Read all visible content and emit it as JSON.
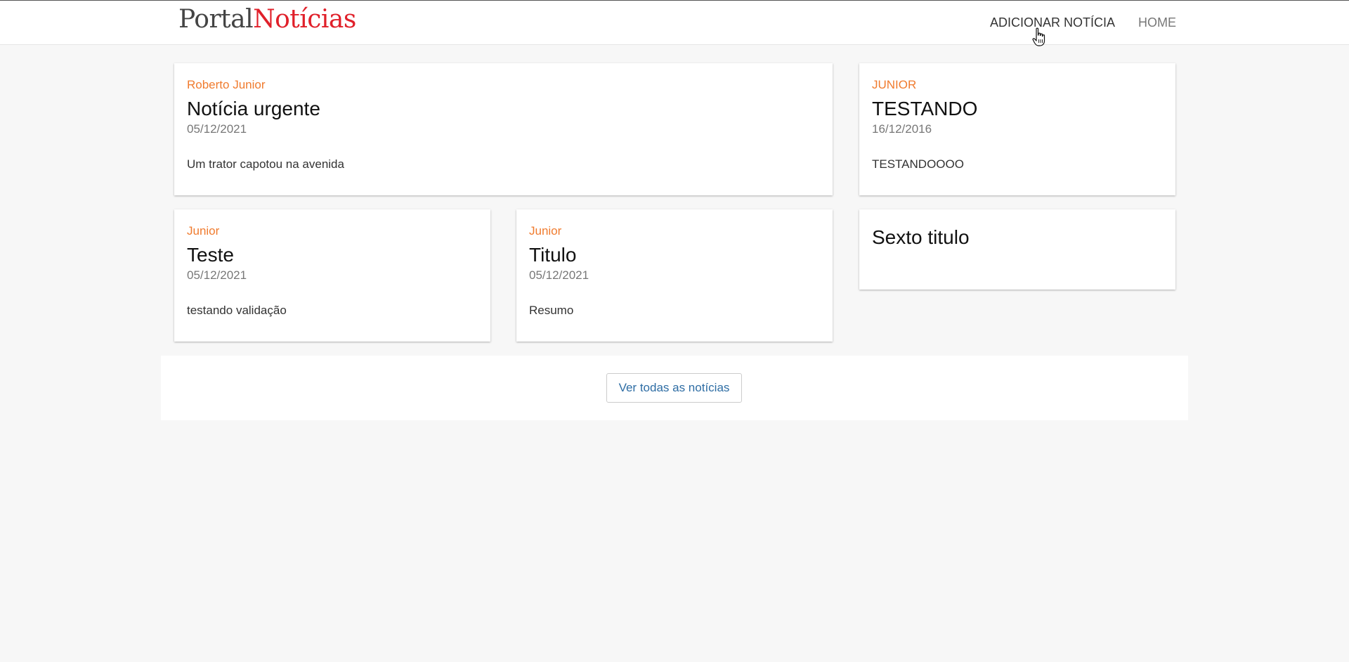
{
  "header": {
    "logo_part1": "Portal",
    "logo_part2": "Notícias",
    "nav": {
      "add_news": "ADICIONAR NOTÍCIA",
      "home": "HOME"
    }
  },
  "cards": [
    {
      "author": "Roberto Junior",
      "title": "Notícia urgente",
      "date": "05/12/2021",
      "summary": "Um trator capotou na avenida"
    },
    {
      "author": "JUNIOR",
      "title": "TESTANDO",
      "date": "16/12/2016",
      "summary": "TESTANDOOOO"
    },
    {
      "author": "Junior",
      "title": "Teste",
      "date": "05/12/2021",
      "summary": "testando validação"
    },
    {
      "author": "Junior",
      "title": "Titulo",
      "date": "05/12/2021",
      "summary": "Resumo"
    },
    {
      "title": "Sexto titulo"
    }
  ],
  "more_button": "Ver todas as notícias",
  "colors": {
    "accent_author": "#f07b2e",
    "logo_red": "#e0202a",
    "button_text": "#2e6da4",
    "background": "#f7f7f7"
  },
  "icons": {
    "cursor": "hand-pointer-icon"
  }
}
